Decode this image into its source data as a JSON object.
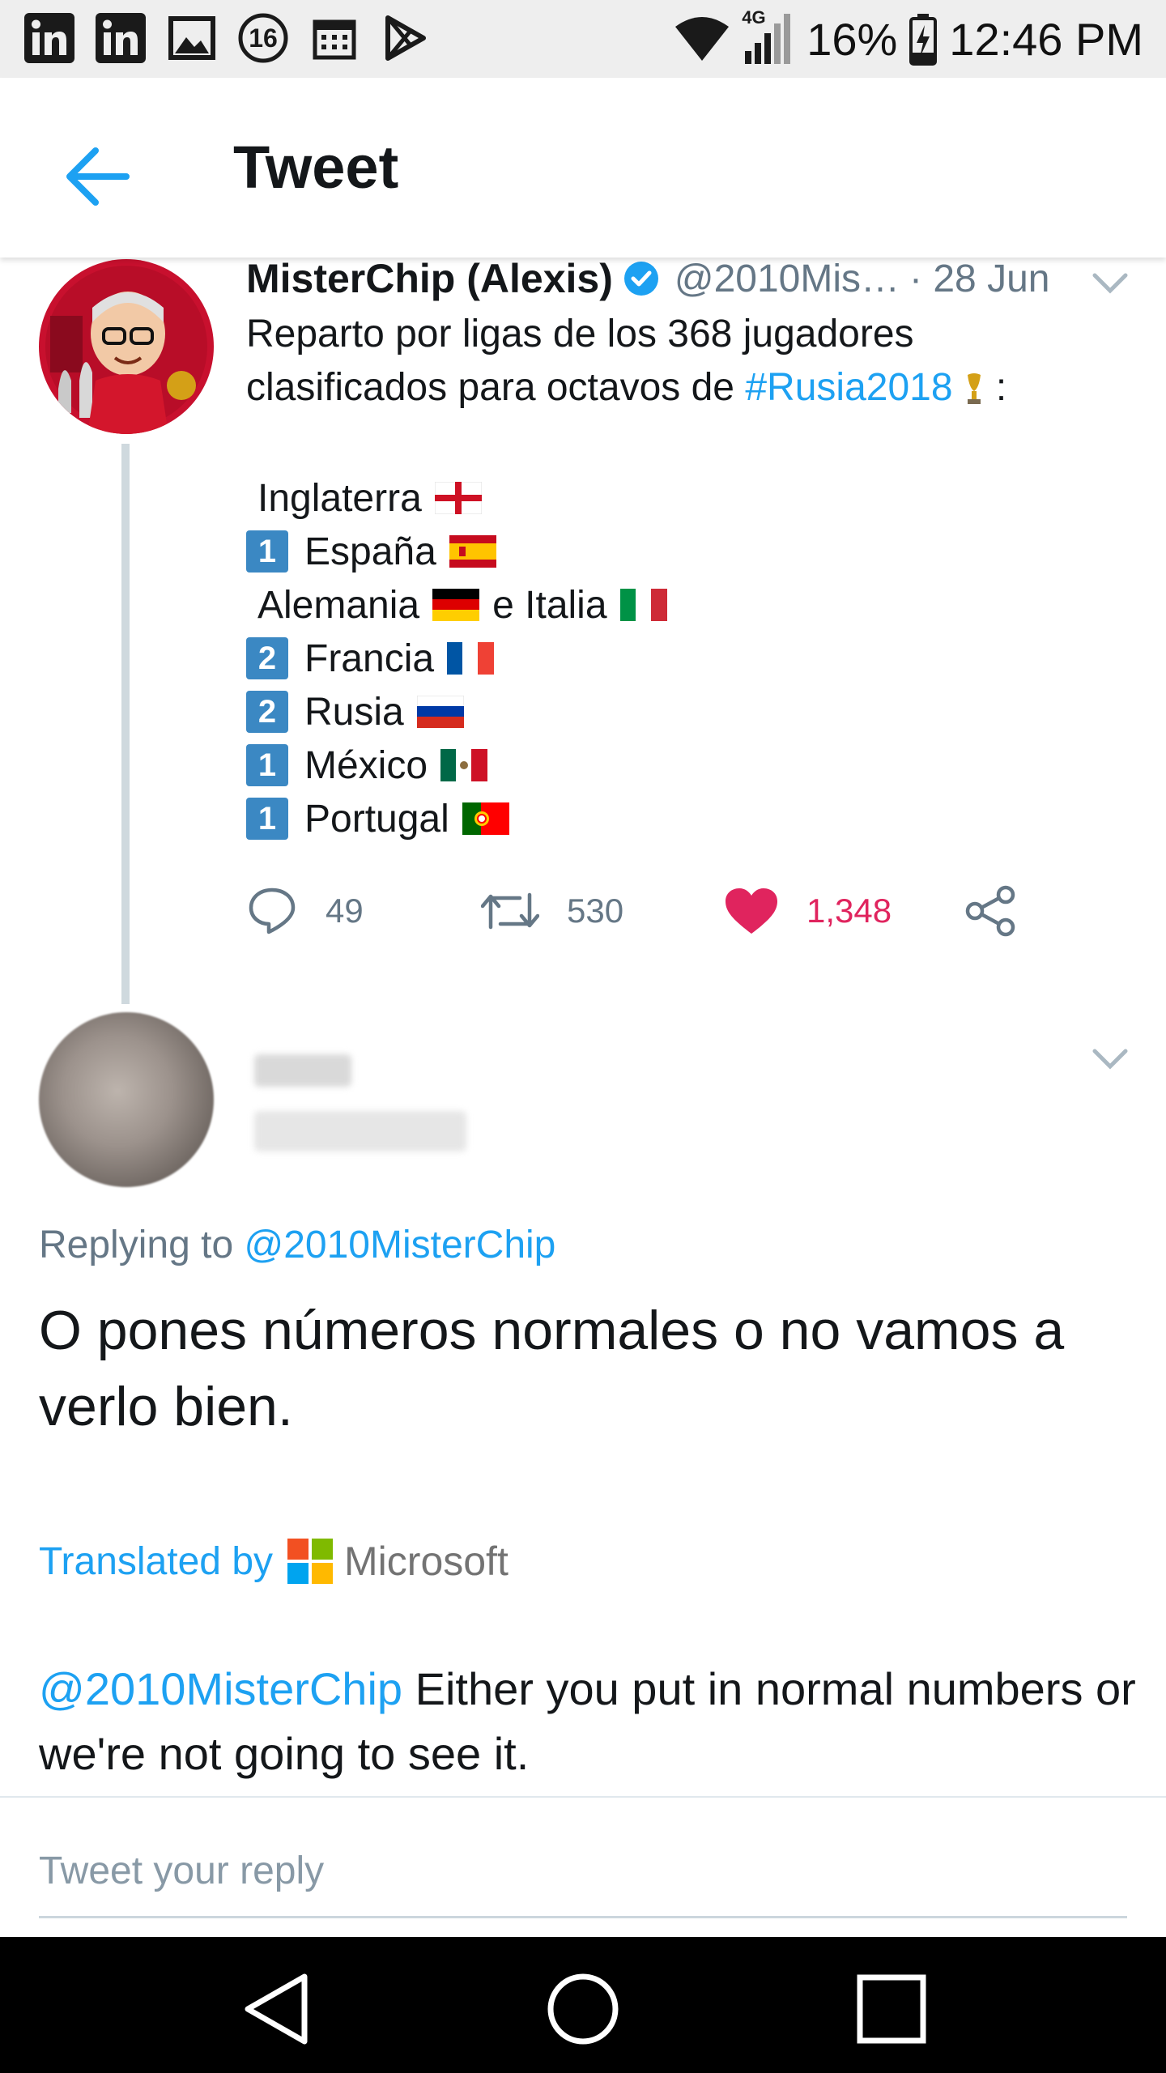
{
  "status_bar": {
    "notification_icons": [
      "linkedin-icon",
      "linkedin-icon",
      "image-icon",
      "circle-16-icon",
      "calendar-icon",
      "play-store-icon"
    ],
    "badge_number": "16",
    "network": "4G",
    "battery": "16%",
    "time": "12:46 PM"
  },
  "header": {
    "title": "Tweet",
    "back_icon": "arrow-left-icon",
    "accent_color": "#1da1f2"
  },
  "tweet": {
    "name": "MisterChip (Alexis)",
    "handle_truncated": "@2010Mis…",
    "date": "· 28 Jun",
    "text_line1": "Reparto por ligas de los 368 jugadores",
    "text_line2_prefix": "clasificados para octavos de ",
    "hashtag": "#Rusia2018",
    "text_line2_suffix": " :",
    "list": [
      {
        "badge": "",
        "label": "Inglaterra",
        "flags": [
          "england"
        ]
      },
      {
        "badge": "1",
        "label": "España",
        "flags": [
          "spain"
        ]
      },
      {
        "badge": "",
        "label": "Alemania",
        "flags": [
          "germany"
        ],
        "label2": "e Italia",
        "flags2": [
          "italy"
        ]
      },
      {
        "badge": "2",
        "label": "Francia",
        "flags": [
          "france"
        ]
      },
      {
        "badge": "2",
        "label": "Rusia",
        "flags": [
          "russia"
        ]
      },
      {
        "badge": "1",
        "label": "México",
        "flags": [
          "mexico"
        ]
      },
      {
        "badge": "1",
        "label": "Portugal",
        "flags": [
          "portugal"
        ]
      }
    ],
    "replies": "49",
    "retweets": "530",
    "likes": "1,348",
    "like_color": "#e0245e"
  },
  "reply": {
    "replying_prefix": "Replying to ",
    "replying_to": "@2010MisterChip",
    "text": "O pones números normales o no vamos a verlo bien.",
    "translated_by": "Translated by",
    "translator": "Microsoft",
    "translation_mention": "@2010MisterChip",
    "translation_text": " Either you put in normal numbers or we're not going to see it."
  },
  "compose": {
    "placeholder": "Tweet your reply"
  },
  "nav": {
    "buttons": [
      "back-triangle-icon",
      "home-circle-icon",
      "recents-square-icon"
    ]
  }
}
